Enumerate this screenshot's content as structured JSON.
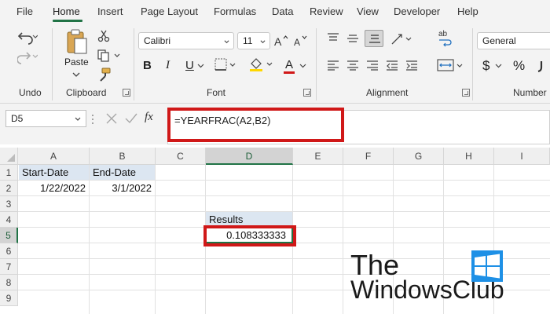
{
  "menu": {
    "tabs": [
      {
        "label": "File"
      },
      {
        "label": "Home"
      },
      {
        "label": "Insert"
      },
      {
        "label": "Page Layout"
      },
      {
        "label": "Formulas"
      },
      {
        "label": "Data"
      },
      {
        "label": "Review"
      },
      {
        "label": "View"
      },
      {
        "label": "Developer"
      },
      {
        "label": "Help"
      }
    ],
    "active": "Home"
  },
  "ribbon": {
    "groups": {
      "undo": "Undo",
      "clipboard": "Clipboard",
      "font": "Font",
      "alignment": "Alignment",
      "number": "Number"
    },
    "paste_label": "Paste",
    "font_name": "Calibri",
    "font_size": "11",
    "number_format": "General",
    "bold_label": "B",
    "italic_label": "I",
    "underline_label": "U",
    "font_color_label": "A",
    "currency_symbol": "$",
    "percent_symbol": "%",
    "wrap_icon_text": "ab"
  },
  "formula_bar": {
    "name_box": "D5",
    "fx_label": "fx",
    "formula": "=YEARFRAC(A2,B2)"
  },
  "grid": {
    "columns": [
      "A",
      "B",
      "C",
      "D",
      "E",
      "F",
      "G",
      "H",
      "I"
    ],
    "rows": [
      "1",
      "2",
      "3",
      "4",
      "5",
      "6",
      "7",
      "8",
      "9"
    ],
    "selected_column": "D",
    "selected_row": "5",
    "cells": {
      "A1": "Start-Date",
      "B1": "End-Date",
      "A2": "1/22/2022",
      "B2": "3/1/2022",
      "D4": "Results",
      "D5": "0.108333333"
    }
  },
  "watermark": {
    "line1": "The",
    "line2": "WindowsClub"
  },
  "colors": {
    "accent_green": "#217346",
    "highlight_red": "#d01818",
    "cell_fill": "#dce6f1"
  }
}
